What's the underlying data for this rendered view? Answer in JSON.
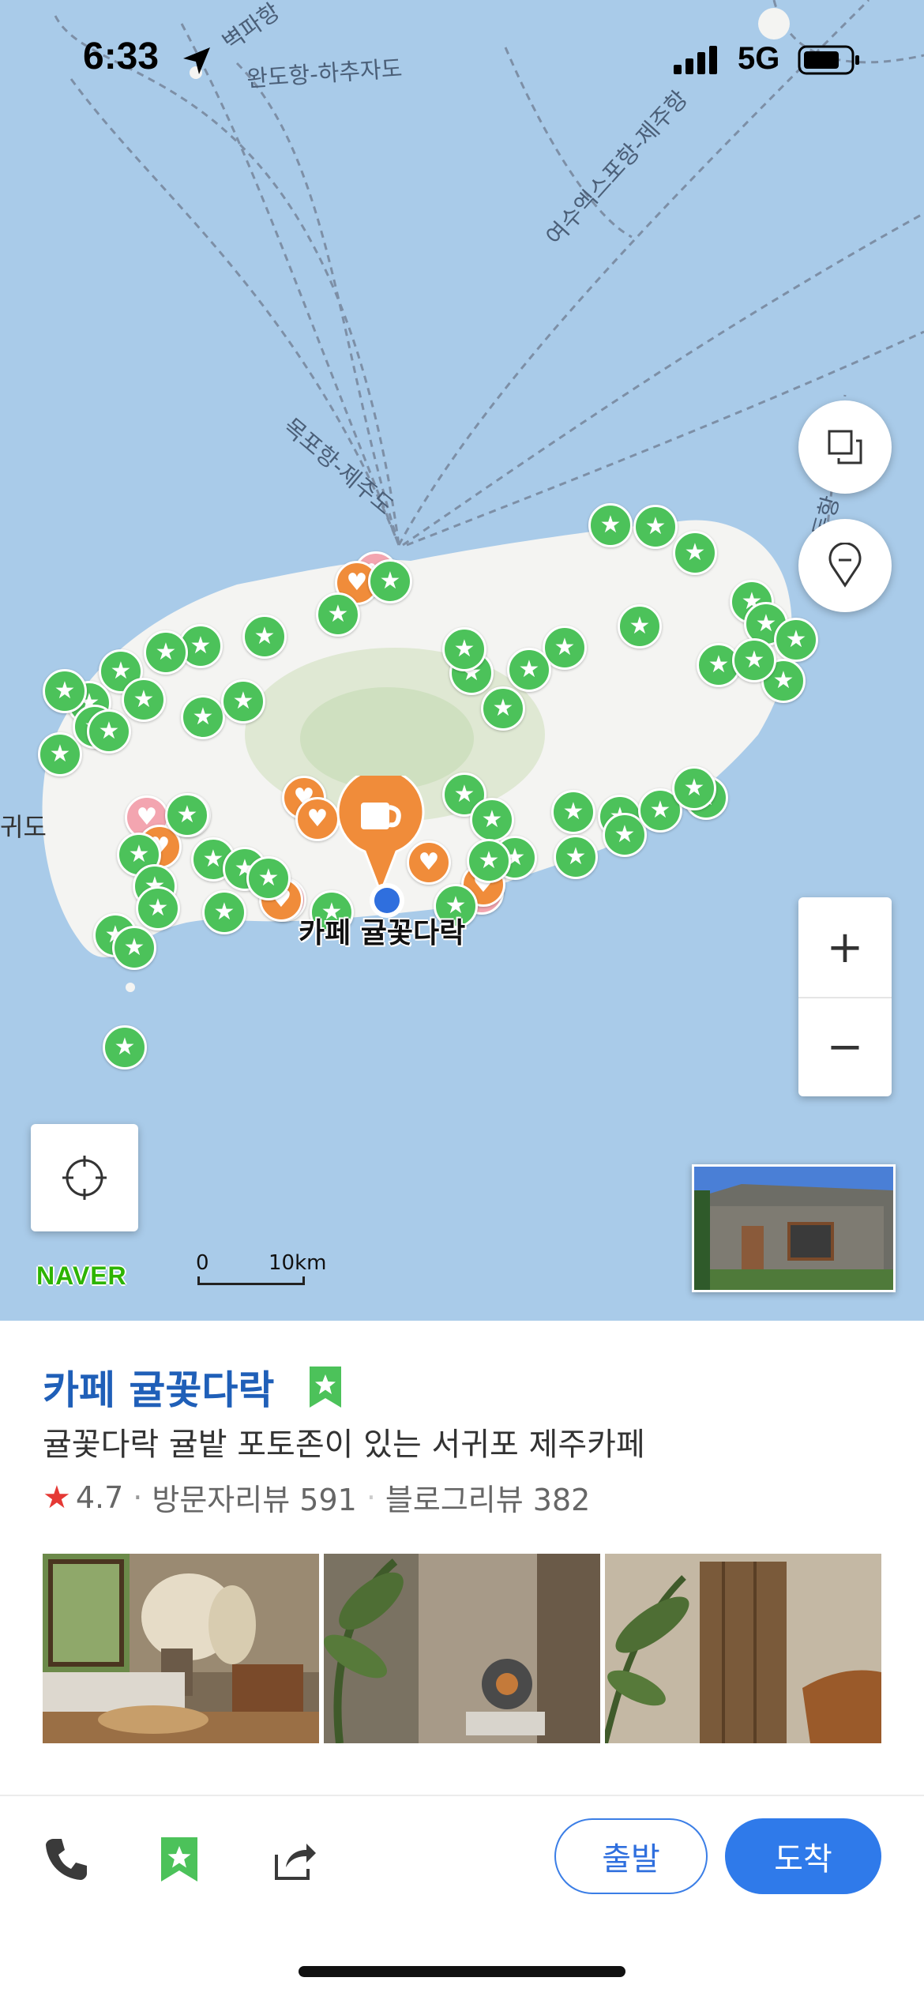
{
  "status_bar": {
    "time": "6:33",
    "network": "5G"
  },
  "map": {
    "route_labels": [
      "완도항-하추자도",
      "여수엑스포항-제주항",
      "목포항-제주도",
      "벽파항",
      "녹동항"
    ],
    "edge_label_left": "귀도",
    "selected_place_label": "카페 귤꽃다락",
    "scale": {
      "zero": "0",
      "distance": "10km"
    },
    "brand": "NAVER",
    "zoom": {
      "in": "+",
      "out": "−"
    },
    "colors": {
      "water": "#a9cbe9",
      "land": "#f4f4f2",
      "star_marker": "#4cc25a",
      "cafe_marker": "#f08c3a",
      "heart_marker": "#f3a5b0",
      "current_location": "#2f6fde"
    }
  },
  "place": {
    "name": "카페 귤꽃다락",
    "description": "귤꽃다락 귤밭 포토존이 있는 서귀포 제주카페",
    "rating": "4.7",
    "visitor_reviews": "방문자리뷰 591",
    "blog_reviews": "블로그리뷰 382"
  },
  "actions": {
    "start": "출발",
    "arrive": "도착"
  }
}
